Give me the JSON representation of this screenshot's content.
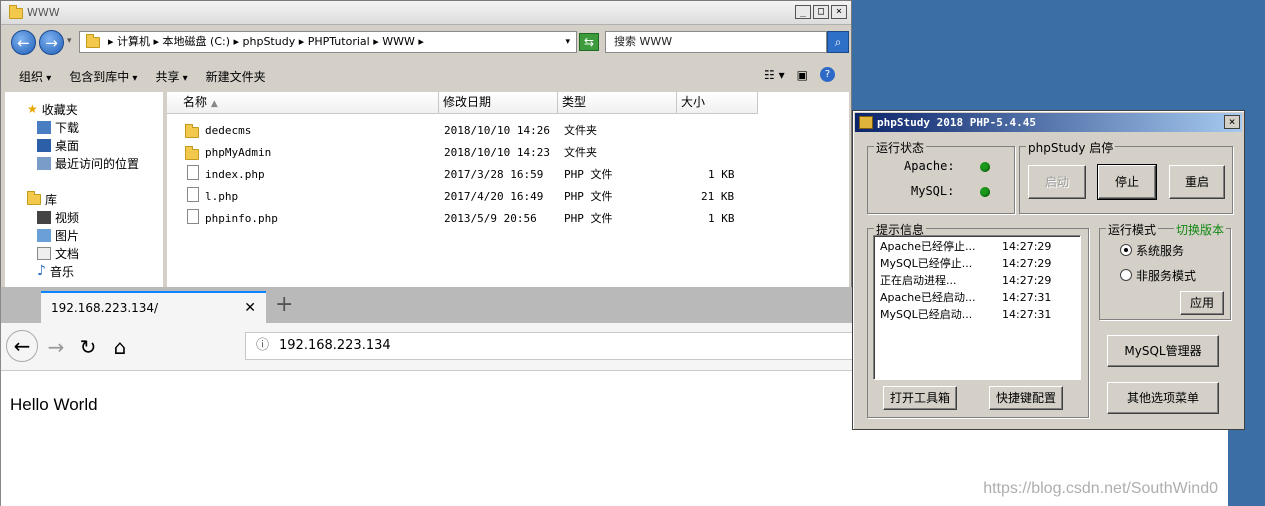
{
  "explorer": {
    "title": "WWW",
    "address": [
      "计算机",
      "本地磁盘 (C:)",
      "phpStudy",
      "PHPTutorial",
      "WWW"
    ],
    "address_text": "▸ 计算机 ▸ 本地磁盘 (C:) ▸ phpStudy ▸ PHPTutorial ▸ WWW ▸",
    "search_placeholder": "搜索 WWW",
    "toolbar": {
      "organize": "组织",
      "include_in_library": "包含到库中",
      "share": "共享",
      "new_folder": "新建文件夹"
    },
    "nav": {
      "favorites": "收藏夹",
      "downloads": "下载",
      "desktop": "桌面",
      "recent": "最近访问的位置",
      "libraries": "库",
      "videos": "视频",
      "pictures": "图片",
      "documents": "文档",
      "music": "音乐"
    },
    "columns": {
      "name": "名称",
      "modified": "修改日期",
      "type": "类型",
      "size": "大小"
    },
    "files": [
      {
        "name": "dedecms",
        "modified": "2018/10/10 14:26",
        "type": "文件夹",
        "size": "",
        "icon": "folder-icon"
      },
      {
        "name": "phpMyAdmin",
        "modified": "2018/10/10 14:23",
        "type": "文件夹",
        "size": "",
        "icon": "folder-icon"
      },
      {
        "name": "index.php",
        "modified": "2017/3/28 16:59",
        "type": "PHP 文件",
        "size": "1 KB",
        "icon": "php-file-icon"
      },
      {
        "name": "l.php",
        "modified": "2017/4/20 16:49",
        "type": "PHP 文件",
        "size": "21 KB",
        "icon": "php-file-icon"
      },
      {
        "name": "phpinfo.php",
        "modified": "2013/5/9 20:56",
        "type": "PHP 文件",
        "size": "1 KB",
        "icon": "php-file-icon"
      }
    ]
  },
  "browser": {
    "tab_title": "192.168.223.134/",
    "url": "192.168.223.134",
    "page_text": "Hello World"
  },
  "phpstudy": {
    "title": "phpStudy 2018    PHP-5.4.45",
    "status_group": "运行状态",
    "apache_label": "Apache:",
    "mysql_label": "MySQL:",
    "control_group": "phpStudy 启停",
    "start": "启动",
    "stop": "停止",
    "restart": "重启",
    "info_group": "提示信息",
    "logs": [
      {
        "msg": "Apache已经停止...",
        "time": "14:27:29"
      },
      {
        "msg": "MySQL已经停止...",
        "time": "14:27:29"
      },
      {
        "msg": "正在启动进程...",
        "time": "14:27:29"
      },
      {
        "msg": "Apache已经启动...",
        "time": "14:27:31"
      },
      {
        "msg": "MySQL已经启动...",
        "time": "14:27:31"
      }
    ],
    "mode_group": "运行模式",
    "switch_version": "切换版本",
    "system_service": "系统服务",
    "non_service": "非服务模式",
    "apply": "应用",
    "open_toolbox": "打开工具箱",
    "quick_config": "快捷键配置",
    "mysql_manager": "MySQL管理器",
    "other_menu": "其他选项菜单",
    "status_color": "#1c9a1c"
  },
  "watermark": "https://blog.csdn.net/SouthWind0"
}
